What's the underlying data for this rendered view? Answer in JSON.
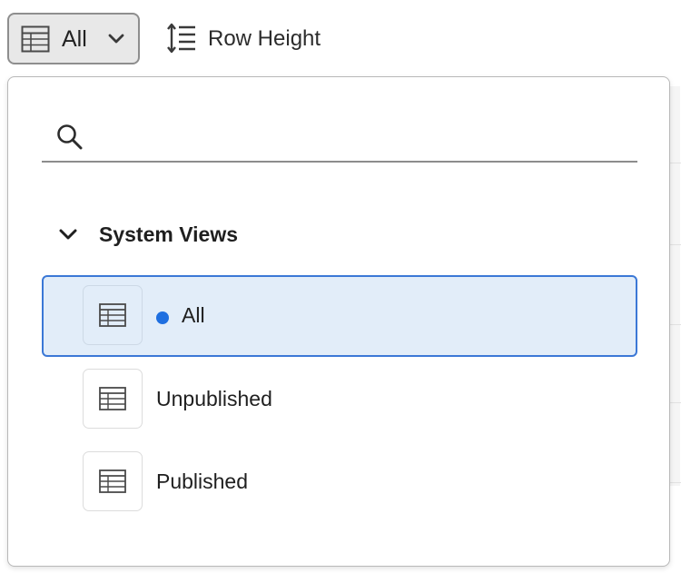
{
  "toolbar": {
    "view_label": "All",
    "row_height_label": "Row Height"
  },
  "search": {
    "value": "",
    "placeholder": ""
  },
  "section": {
    "title": "System Views"
  },
  "views": [
    {
      "label": "All",
      "selected": true
    },
    {
      "label": "Unpublished",
      "selected": false
    },
    {
      "label": "Published",
      "selected": false
    }
  ],
  "colors": {
    "selected_bg": "#e2edf9",
    "selected_border": "#3b78d6",
    "selected_dot": "#1f6fe0"
  },
  "icons": {
    "view_button": "table-icon",
    "view_chevron": "chevron-down-icon",
    "row_height": "row-height-icon",
    "search": "search-icon",
    "section": "chevron-down-icon",
    "view_item": "table-icon"
  }
}
